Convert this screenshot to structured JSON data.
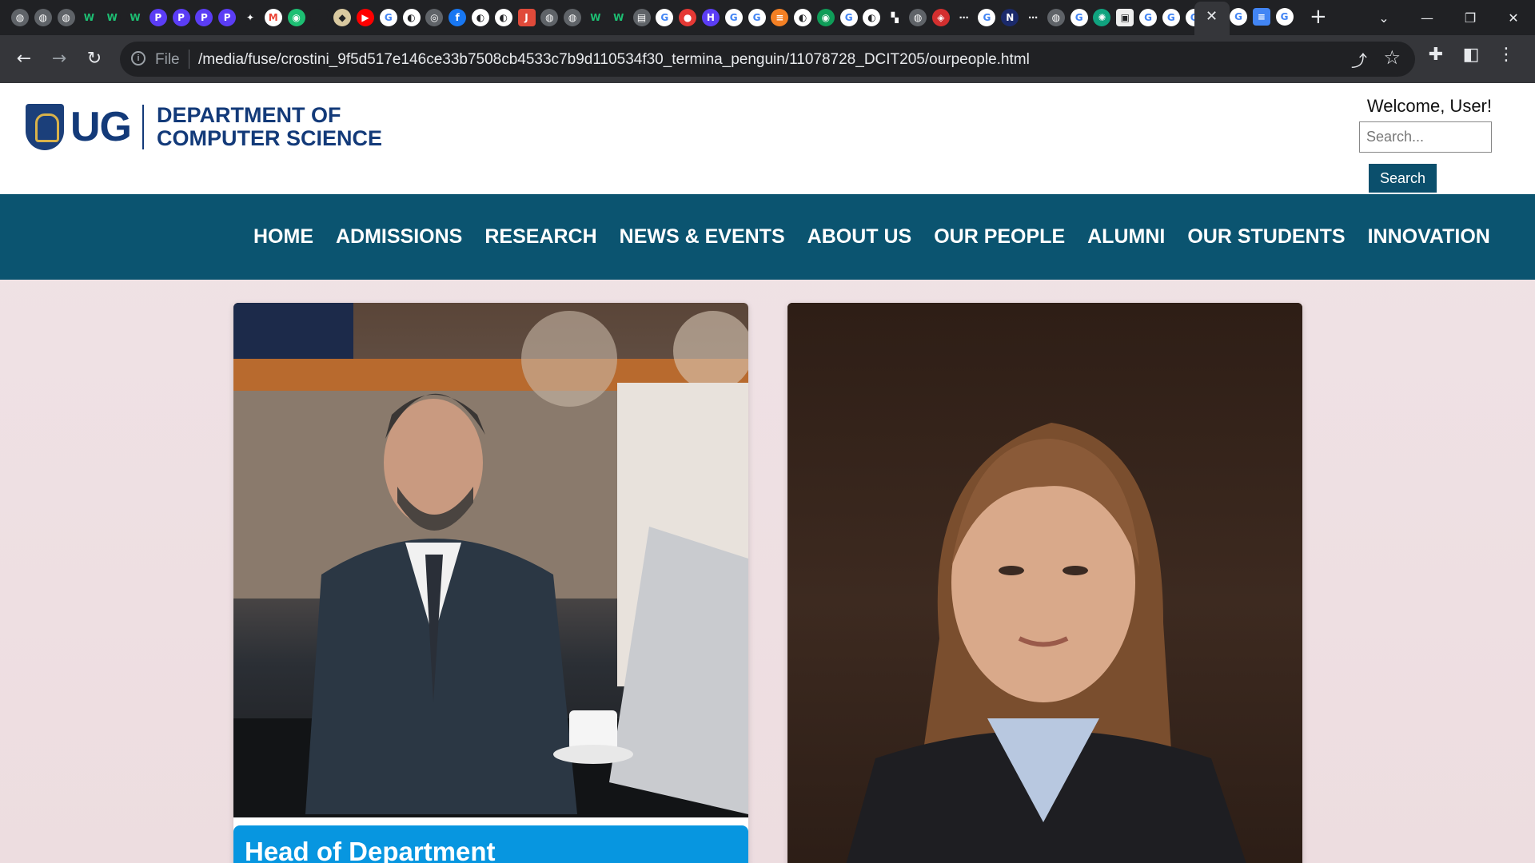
{
  "browser": {
    "tab_icons": [
      "globe-icon",
      "globe-icon",
      "globe-icon",
      "w-icon",
      "w-icon",
      "w-icon",
      "p-icon",
      "p-icon",
      "p-icon",
      "p-icon",
      "figure-icon",
      "gmail-icon",
      "chat-icon",
      "blank-icon",
      "crest-icon",
      "youtube-icon",
      "google-icon",
      "github-icon",
      "fingerprint-icon",
      "facebook-icon",
      "github-icon",
      "github-icon",
      "jpg-png-icon",
      "globe-icon",
      "globe-icon",
      "w-icon",
      "w-icon",
      "doc-icon",
      "google-icon",
      "record-icon",
      "h-icon",
      "google-icon",
      "google-icon",
      "stack-icon",
      "github-icon",
      "badge-icon",
      "google-icon",
      "github-icon",
      "chart-icon",
      "globe-icon",
      "shield-icon",
      "dots-icon",
      "google-icon",
      "ntu-icon",
      "dots-icon",
      "globe-icon",
      "google-icon",
      "openai-icon",
      "image-icon",
      "google-icon",
      "google-icon",
      "google-icon"
    ],
    "active_tab_close": "✕",
    "right_tab_icons": [
      "google-icon",
      "docs-icon",
      "google-icon"
    ],
    "new_tab": "+",
    "window_controls": [
      "⌄",
      "—",
      "❐",
      "✕"
    ],
    "url_scheme": "File",
    "url": "/media/fuse/crostini_9f5d517e146ce33b7508cb4533c7b9d110534f30_termina_penguin/11078728_DCIT205/ourpeople.html"
  },
  "header": {
    "logo_short": "UG",
    "dept_line1": "DEPARTMENT OF",
    "dept_line2": "COMPUTER SCIENCE",
    "welcome": "Welcome, User!",
    "search_placeholder": "Search...",
    "search_button": "Search"
  },
  "nav": {
    "items": [
      "HOME",
      "ADMISSIONS",
      "RESEARCH",
      "NEWS & EVENTS",
      "ABOUT US",
      "OUR PEOPLE",
      "ALUMNI",
      "OUR STUDENTS",
      "INNOVATION"
    ]
  },
  "cards": [
    {
      "title": "Head of Department"
    },
    {
      "title": ""
    }
  ],
  "colors": {
    "nav_bg": "#0b5470",
    "brand": "#133a79",
    "card_title_bg": "#0796e0",
    "page_bg": "#f0e3e6"
  }
}
